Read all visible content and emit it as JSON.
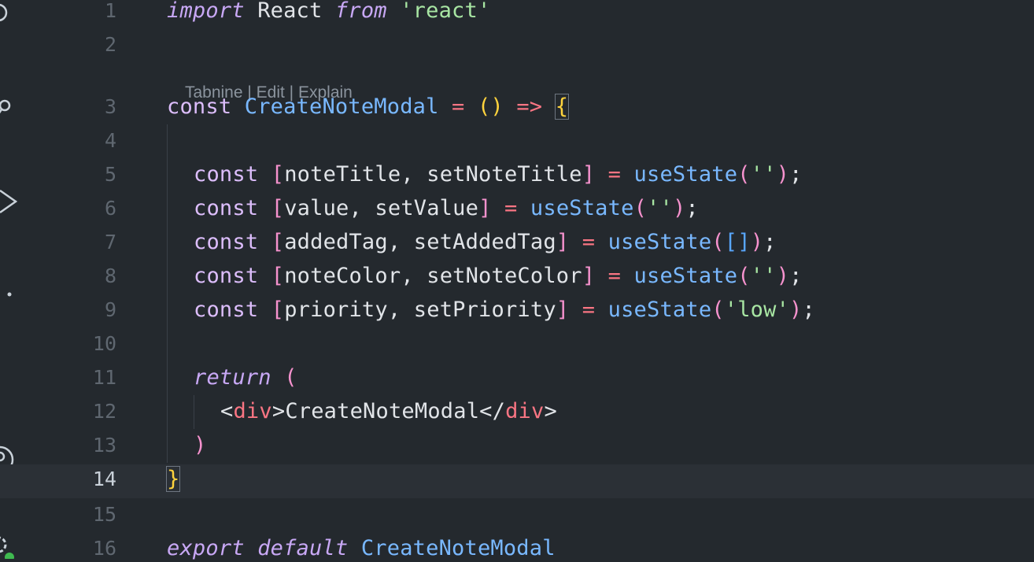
{
  "codelens": {
    "tabnine": "Tabnine",
    "sep1": " | ",
    "edit": "Edit",
    "sep2": " | ",
    "explain": "Explain"
  },
  "lines": [
    {
      "num": "1"
    },
    {
      "num": "2"
    },
    {
      "num": "3"
    },
    {
      "num": "4"
    },
    {
      "num": "5"
    },
    {
      "num": "6"
    },
    {
      "num": "7"
    },
    {
      "num": "8"
    },
    {
      "num": "9"
    },
    {
      "num": "10"
    },
    {
      "num": "11"
    },
    {
      "num": "12"
    },
    {
      "num": "13"
    },
    {
      "num": "14"
    },
    {
      "num": "15"
    },
    {
      "num": "16"
    }
  ],
  "code": {
    "l1": {
      "import": "import",
      "react": " React ",
      "from": "from",
      "mod": " 'react'"
    },
    "l3": {
      "const": "const",
      "name": " CreateNoteModal",
      "eq": " = ",
      "paren": "()",
      "arrow": " => ",
      "brace": "{"
    },
    "l5": {
      "const": "const",
      "open": " [",
      "a": "noteTitle",
      "comma": ", ",
      "b": "setNoteTitle",
      "close": "]",
      "eq": " = ",
      "fn": "useState",
      "po": "(",
      "arg": "''",
      "pc": ")",
      "semi": ";"
    },
    "l6": {
      "const": "const",
      "open": " [",
      "a": "value",
      "comma": ", ",
      "b": "setValue",
      "close": "]",
      "eq": " = ",
      "fn": "useState",
      "po": "(",
      "arg": "''",
      "pc": ")",
      "semi": ";"
    },
    "l7": {
      "const": "const",
      "open": " [",
      "a": "addedTag",
      "comma": ", ",
      "b": "setAddedTag",
      "close": "]",
      "eq": " = ",
      "fn": "useState",
      "po": "(",
      "arg": "[]",
      "pc": ")",
      "semi": ";"
    },
    "l8": {
      "const": "const",
      "open": " [",
      "a": "noteColor",
      "comma": ", ",
      "b": "setNoteColor",
      "close": "]",
      "eq": " = ",
      "fn": "useState",
      "po": "(",
      "arg": "''",
      "pc": ")",
      "semi": ";"
    },
    "l9": {
      "const": "const",
      "open": " [",
      "a": "priority",
      "comma": ", ",
      "b": "setPriority",
      "close": "]",
      "eq": " = ",
      "fn": "useState",
      "po": "(",
      "arg": "'low'",
      "pc": ")",
      "semi": ";"
    },
    "l11": {
      "ret": "return",
      "po": " ("
    },
    "l12": {
      "lt": "<",
      "tag": "div",
      "gt": ">",
      "text": "CreateNoteModal",
      "lt2": "</",
      "tag2": "div",
      "gt2": ">"
    },
    "l13": {
      "pc": ")"
    },
    "l14": {
      "brace": "}"
    },
    "l16": {
      "export": "export",
      "default": " default",
      "name": " CreateNoteModal"
    }
  },
  "colors": {
    "background": "#24292e",
    "current_line": "#2b3036",
    "keyword": "#d2a8ff",
    "function": "#79b8ff",
    "string": "#a8e6a3",
    "bracket_yellow": "#ffd33d",
    "bracket_pink": "#f692ce"
  }
}
